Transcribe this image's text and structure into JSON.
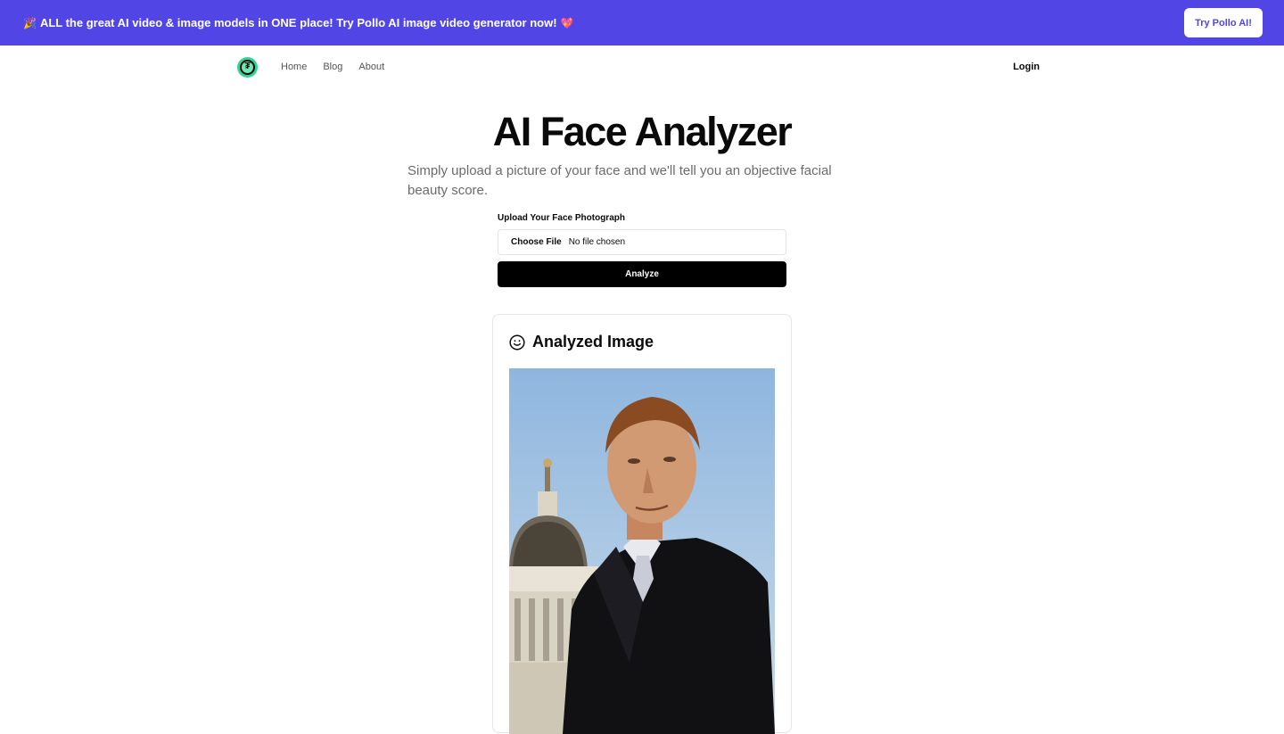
{
  "banner": {
    "emoji_left": "🎉",
    "text": "ALL the great AI video & image models in ONE place! Try Pollo AI image video generator now!",
    "emoji_right": "💖",
    "button": "Try Pollo AI!",
    "bg_color": "#5146e5"
  },
  "nav": {
    "logo_glyph": "₮",
    "links": [
      "Home",
      "Blog",
      "About"
    ],
    "login": "Login"
  },
  "hero": {
    "title": "AI Face Analyzer",
    "subtitle": "Simply upload a picture of your face and we'll tell you an objective facial beauty score."
  },
  "upload": {
    "label": "Upload Your Face Photograph",
    "choose_button": "Choose File",
    "status": "No file chosen",
    "analyze_button": "Analyze"
  },
  "result": {
    "icon": "smile-icon",
    "title": "Analyzed Image"
  }
}
